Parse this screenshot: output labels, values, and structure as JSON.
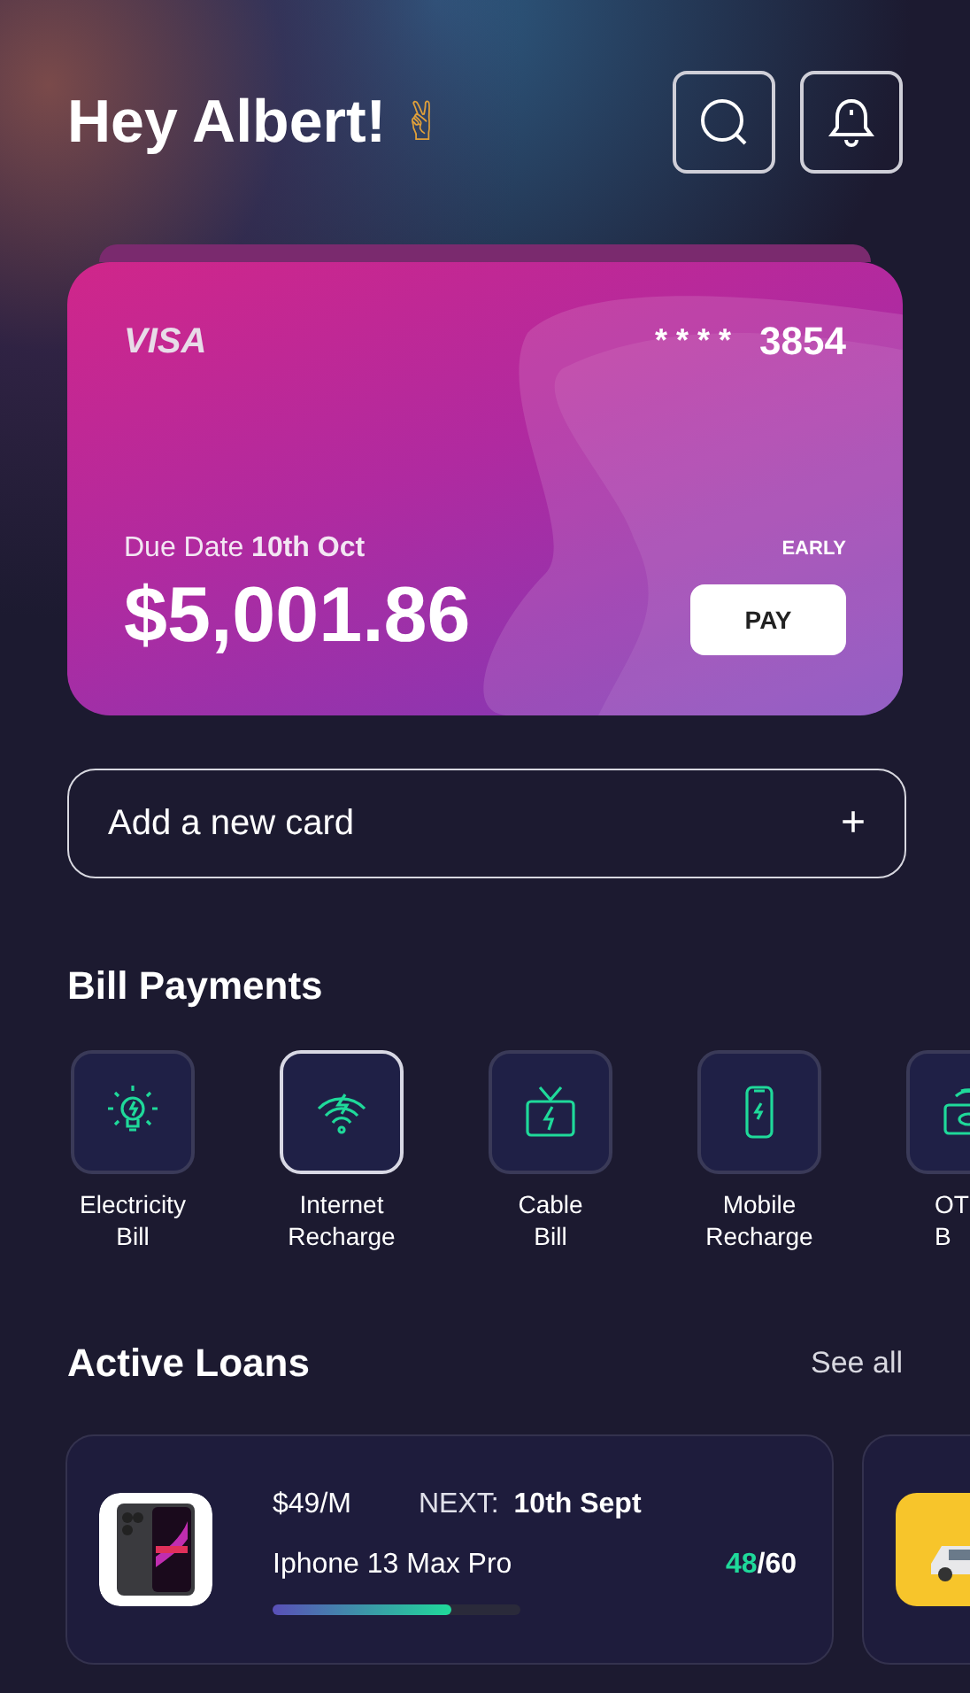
{
  "greeting": {
    "text": "Hey Albert!",
    "emoji": "✌"
  },
  "header_buttons": [
    {
      "kind": "search"
    },
    {
      "kind": "bell"
    }
  ],
  "card": {
    "brand": "VISA",
    "mask": "* * * *",
    "last_digits": "3854",
    "due_label": "Due Date",
    "due_date": "10th Oct",
    "amount": "$5,001.86",
    "tag": "EARLY",
    "button": "PAY"
  },
  "add_card": {
    "label": "Add a new card",
    "icon": "+"
  },
  "bill_payments": {
    "title": "Bill Payments",
    "items": [
      {
        "kind": "bulb",
        "lines": [
          "Electricity",
          "Bill"
        ],
        "selected": false
      },
      {
        "kind": "wifi",
        "lines": [
          "Internet",
          "Recharge"
        ],
        "selected": true
      },
      {
        "kind": "tv",
        "lines": [
          "Cable",
          "Bill"
        ],
        "selected": false
      },
      {
        "kind": "phone",
        "lines": [
          "Mobile",
          "Recharge"
        ],
        "selected": false
      },
      {
        "kind": "ott",
        "lines": [
          "OT",
          "B"
        ],
        "selected": false
      }
    ]
  },
  "active_loans": {
    "title": "Active Loans",
    "link": "See all",
    "items": [
      {
        "kind": "full",
        "price": "$49/M",
        "next_label": "NEXT:",
        "next_date": "10th Sept",
        "name": "Iphone 13 Max Pro",
        "paid": "48",
        "total": "/60",
        "level": 0.72
      },
      {
        "kind": "partial"
      }
    ]
  }
}
